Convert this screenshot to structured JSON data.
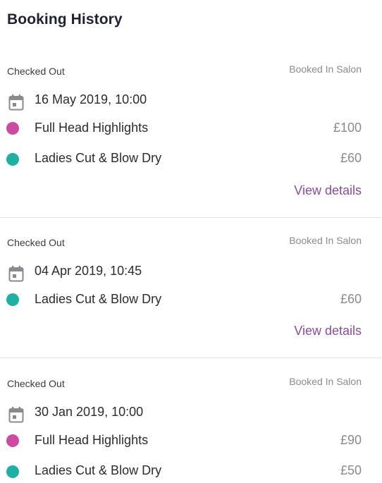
{
  "header": {
    "title": "Booking History"
  },
  "colors": {
    "highlights_dot": "#cc4a9f",
    "cut_dot": "#1eb0a3",
    "link": "#8d4a9e"
  },
  "bookings": [
    {
      "status": "Checked Out",
      "channel": "Booked In Salon",
      "date": "16 May 2019, 10:00",
      "services": [
        {
          "name": "Full Head Highlights",
          "price": "£100",
          "color": "#cc4a9f"
        },
        {
          "name": "Ladies Cut & Blow Dry",
          "price": "£60",
          "color": "#1eb0a3"
        }
      ],
      "link": "View details"
    },
    {
      "status": "Checked Out",
      "channel": "Booked In Salon",
      "date": "04 Apr 2019, 10:45",
      "services": [
        {
          "name": "Ladies Cut & Blow Dry",
          "price": "£60",
          "color": "#1eb0a3"
        }
      ],
      "link": "View details"
    },
    {
      "status": "Checked Out",
      "channel": "Booked In Salon",
      "date": "30 Jan 2019, 10:00",
      "services": [
        {
          "name": "Full Head Highlights",
          "price": "£90",
          "color": "#cc4a9f"
        },
        {
          "name": "Ladies Cut & Blow Dry",
          "price": "£50",
          "color": "#1eb0a3"
        }
      ]
    }
  ]
}
